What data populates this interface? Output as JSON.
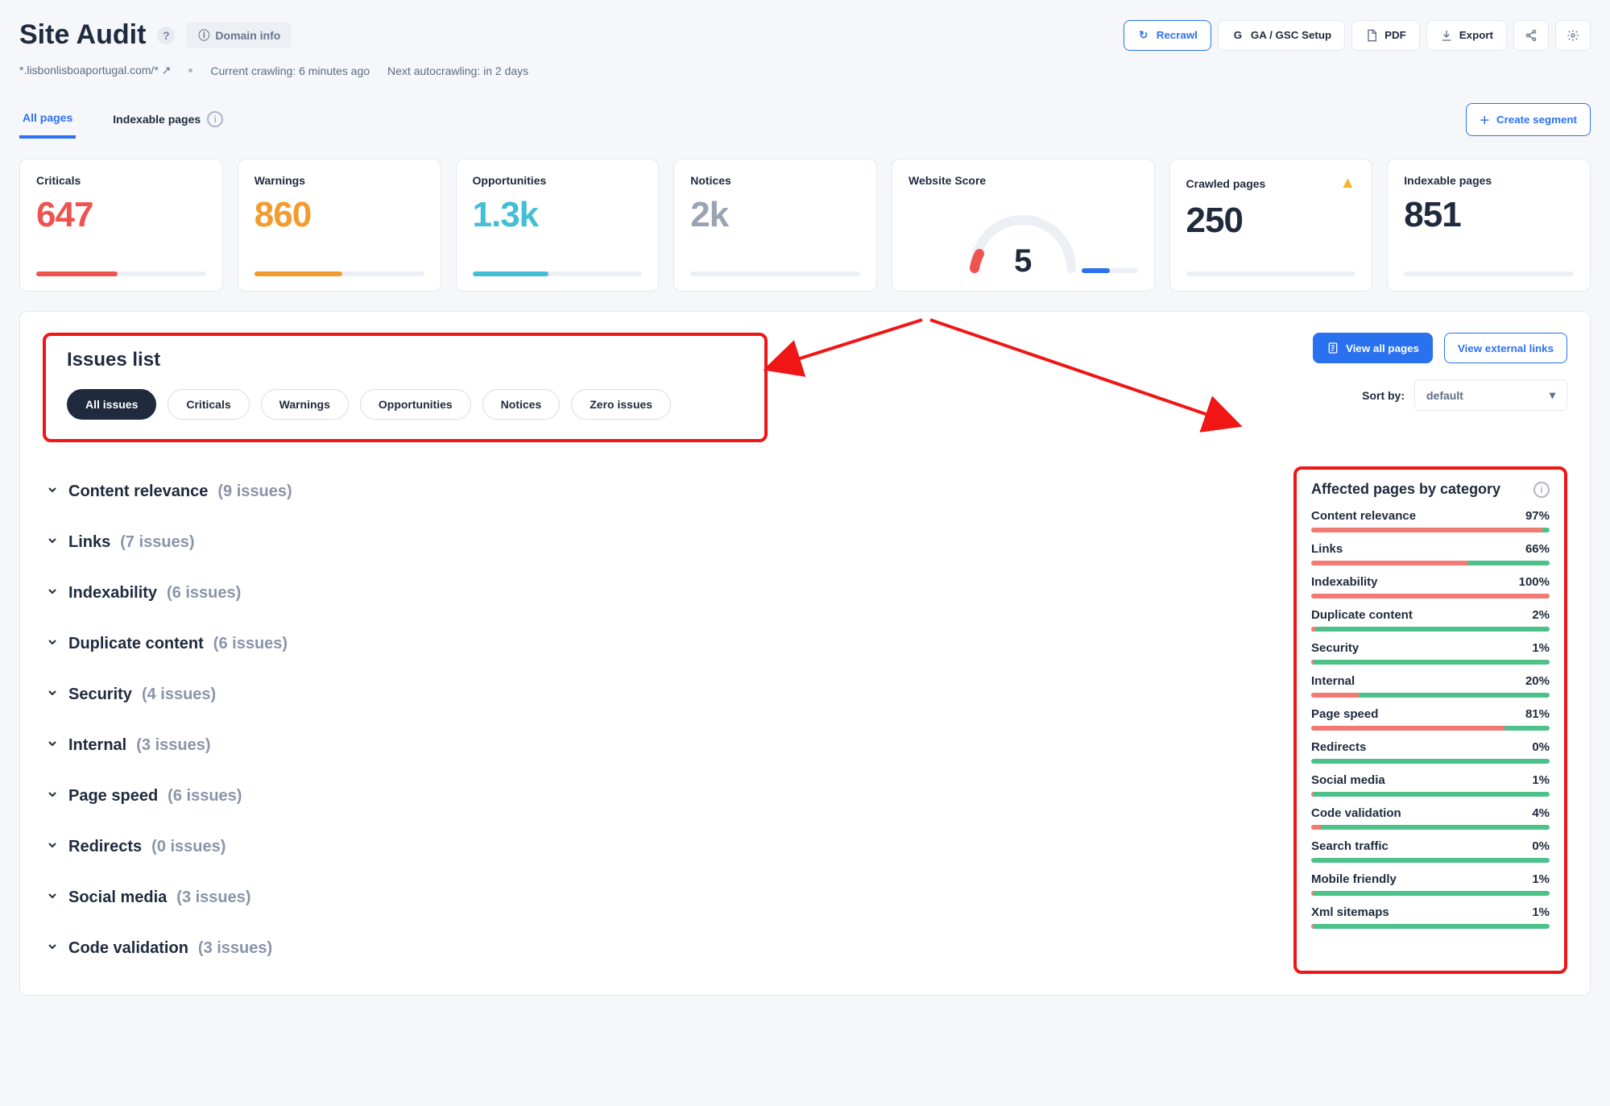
{
  "header": {
    "title": "Site Audit",
    "domain_info_label": "Domain info",
    "buttons": {
      "recrawl": "Recrawl",
      "ga_gsc": "GA / GSC Setup",
      "pdf": "PDF",
      "export": "Export"
    }
  },
  "subtitle": {
    "domain": "*.lisbonlisboaportugal.com/*",
    "crawl_time": "Current crawling: 6 minutes ago",
    "next_crawl": "Next autocrawling: in 2 days"
  },
  "tabs": {
    "all_pages": "All pages",
    "indexable": "Indexable pages",
    "create_segment": "Create segment"
  },
  "stats": {
    "criticals": {
      "label": "Criticals",
      "value": "647"
    },
    "warnings": {
      "label": "Warnings",
      "value": "860"
    },
    "opportunities": {
      "label": "Opportunities",
      "value": "1.3k"
    },
    "notices": {
      "label": "Notices",
      "value": "2k"
    },
    "score": {
      "label": "Website Score",
      "value": "5"
    },
    "crawled": {
      "label": "Crawled pages",
      "value": "250"
    },
    "indexable": {
      "label": "Indexable pages",
      "value": "851"
    }
  },
  "issues": {
    "title": "Issues list",
    "filters": {
      "all": "All issues",
      "criticals": "Criticals",
      "warnings": "Warnings",
      "opportunities": "Opportunities",
      "notices": "Notices",
      "zero": "Zero issues"
    },
    "rows": [
      {
        "name": "Content relevance",
        "count": "(9 issues)"
      },
      {
        "name": "Links",
        "count": "(7 issues)"
      },
      {
        "name": "Indexability",
        "count": "(6 issues)"
      },
      {
        "name": "Duplicate content",
        "count": "(6 issues)"
      },
      {
        "name": "Security",
        "count": "(4 issues)"
      },
      {
        "name": "Internal",
        "count": "(3 issues)"
      },
      {
        "name": "Page speed",
        "count": "(6 issues)"
      },
      {
        "name": "Redirects",
        "count": "(0 issues)"
      },
      {
        "name": "Social media",
        "count": "(3 issues)"
      },
      {
        "name": "Code validation",
        "count": "(3 issues)"
      }
    ]
  },
  "panel_actions": {
    "view_pages": "View all pages",
    "view_external": "View external links",
    "sort_label": "Sort by:",
    "sort_value": "default"
  },
  "affected": {
    "title": "Affected pages by category",
    "rows": [
      {
        "name": "Content relevance",
        "pct": "97%",
        "bad": 97
      },
      {
        "name": "Links",
        "pct": "66%",
        "bad": 66
      },
      {
        "name": "Indexability",
        "pct": "100%",
        "bad": 100
      },
      {
        "name": "Duplicate content",
        "pct": "2%",
        "bad": 2
      },
      {
        "name": "Security",
        "pct": "1%",
        "bad": 1
      },
      {
        "name": "Internal",
        "pct": "20%",
        "bad": 20
      },
      {
        "name": "Page speed",
        "pct": "81%",
        "bad": 81
      },
      {
        "name": "Redirects",
        "pct": "0%",
        "bad": 0
      },
      {
        "name": "Social media",
        "pct": "1%",
        "bad": 1
      },
      {
        "name": "Code validation",
        "pct": "4%",
        "bad": 4
      },
      {
        "name": "Search traffic",
        "pct": "0%",
        "bad": 0
      },
      {
        "name": "Mobile friendly",
        "pct": "1%",
        "bad": 1
      },
      {
        "name": "Xml sitemaps",
        "pct": "1%",
        "bad": 1
      }
    ]
  }
}
